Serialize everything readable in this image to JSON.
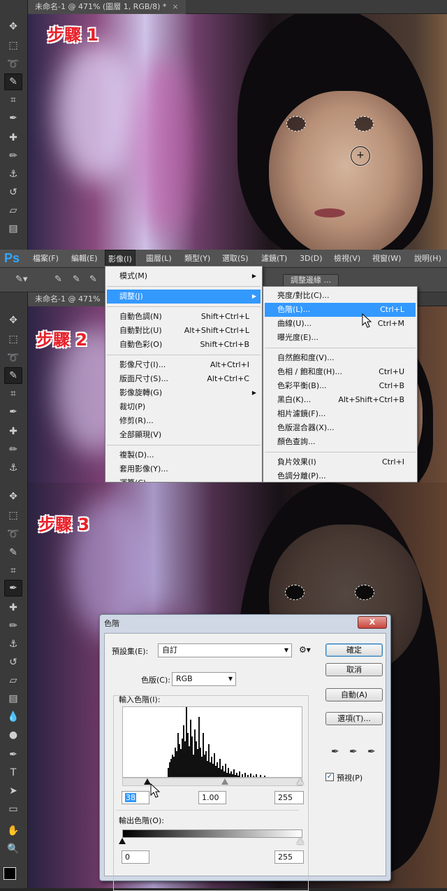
{
  "doc_tab": {
    "label": "未命名-1 @ 471% (圖層 1, RGB/8) *",
    "label_short": "未命名-1 @ 471%",
    "close": "×"
  },
  "steps": {
    "s1": "步驟 1",
    "s2": "步驟 2",
    "s3": "步驟 3"
  },
  "app_logo": "Ps",
  "menubar": [
    "檔案(F)",
    "編輯(E)",
    "影像(I)",
    "圖層(L)",
    "類型(Y)",
    "選取(S)",
    "濾鏡(T)",
    "3D(D)",
    "檢視(V)",
    "視窗(W)",
    "說明(H)"
  ],
  "options_bar": {
    "refine_edge": "調整邊緣 ..."
  },
  "image_menu": [
    {
      "label": "模式(M)",
      "shortcut": "",
      "submenu": true
    },
    {
      "label": "調整(J)",
      "shortcut": "",
      "submenu": true,
      "highlight": true
    },
    {
      "label": "自動色調(N)",
      "shortcut": "Shift+Ctrl+L"
    },
    {
      "label": "自動對比(U)",
      "shortcut": "Alt+Shift+Ctrl+L"
    },
    {
      "label": "自動色彩(O)",
      "shortcut": "Shift+Ctrl+B"
    },
    {
      "label": "影像尺寸(I)...",
      "shortcut": "Alt+Ctrl+I"
    },
    {
      "label": "版面尺寸(S)...",
      "shortcut": "Alt+Ctrl+C"
    },
    {
      "label": "影像旋轉(G)",
      "shortcut": "",
      "submenu": true
    },
    {
      "label": "裁切(P)",
      "shortcut": ""
    },
    {
      "label": "修剪(R)...",
      "shortcut": ""
    },
    {
      "label": "全部顯現(V)",
      "shortcut": ""
    },
    {
      "label": "複製(D)...",
      "shortcut": ""
    },
    {
      "label": "套用影像(Y)...",
      "shortcut": ""
    },
    {
      "label": "運算(C)...",
      "shortcut": ""
    }
  ],
  "adjust_menu": [
    {
      "label": "亮度/對比(C)...",
      "shortcut": ""
    },
    {
      "label": "色階(L)...",
      "shortcut": "Ctrl+L",
      "highlight": true
    },
    {
      "label": "曲線(U)...",
      "shortcut": "Ctrl+M"
    },
    {
      "label": "曝光度(E)...",
      "shortcut": ""
    },
    {
      "label": "自然飽和度(V)...",
      "shortcut": ""
    },
    {
      "label": "色相 / 飽和度(H)...",
      "shortcut": "Ctrl+U"
    },
    {
      "label": "色彩平衡(B)...",
      "shortcut": "Ctrl+B"
    },
    {
      "label": "黑白(K)...",
      "shortcut": "Alt+Shift+Ctrl+B"
    },
    {
      "label": "相片濾鏡(F)...",
      "shortcut": ""
    },
    {
      "label": "色版混合器(X)...",
      "shortcut": ""
    },
    {
      "label": "顏色查詢...",
      "shortcut": ""
    },
    {
      "label": "負片效果(I)",
      "shortcut": "Ctrl+I"
    },
    {
      "label": "色調分離(P)...",
      "shortcut": ""
    }
  ],
  "levels_dialog": {
    "title": "色階",
    "close": "X",
    "preset_label": "預設集(E):",
    "preset_value": "自訂",
    "channel_label": "色版(C):",
    "channel_value": "RGB",
    "input_label": "輸入色階(I):",
    "input_black": "38",
    "input_gamma": "1.00",
    "input_white": "255",
    "output_label": "輸出色階(O):",
    "output_black": "0",
    "output_white": "255",
    "ok": "確定",
    "cancel": "取消",
    "auto": "自動(A)",
    "options": "選項(T)...",
    "preview": "預視(P)",
    "preview_checked": "✓",
    "settings_icon": "gear-icon"
  },
  "histogram": [
    0,
    0,
    0,
    0,
    0,
    0,
    0,
    0,
    0,
    0,
    0,
    0,
    0,
    0,
    0,
    0,
    0,
    0,
    0,
    0,
    0,
    0,
    0,
    0,
    0,
    0,
    0,
    0,
    0,
    0,
    0,
    0,
    12,
    20,
    25,
    30,
    28,
    40,
    35,
    60,
    45,
    38,
    52,
    70,
    48,
    95,
    60,
    42,
    78,
    55,
    30,
    65,
    48,
    38,
    82,
    40,
    28,
    60,
    30,
    35,
    22,
    45,
    20,
    28,
    18,
    32,
    15,
    20,
    12,
    25,
    10,
    15,
    8,
    18,
    6,
    12,
    5,
    8,
    4,
    10,
    3,
    6,
    2,
    8,
    0,
    4,
    0,
    6,
    0,
    3,
    0,
    5,
    0,
    2,
    0,
    4,
    0,
    0,
    3,
    0,
    0,
    2,
    0,
    0,
    0,
    0,
    0,
    0,
    0,
    0,
    0,
    0,
    0,
    0,
    0,
    0,
    0,
    0,
    0,
    0,
    0,
    0,
    0,
    0,
    0,
    0,
    0,
    0
  ],
  "colors": {
    "highlight": "#3399ff",
    "step_red": "#e8202a",
    "ps_blue": "#31a8ff"
  }
}
